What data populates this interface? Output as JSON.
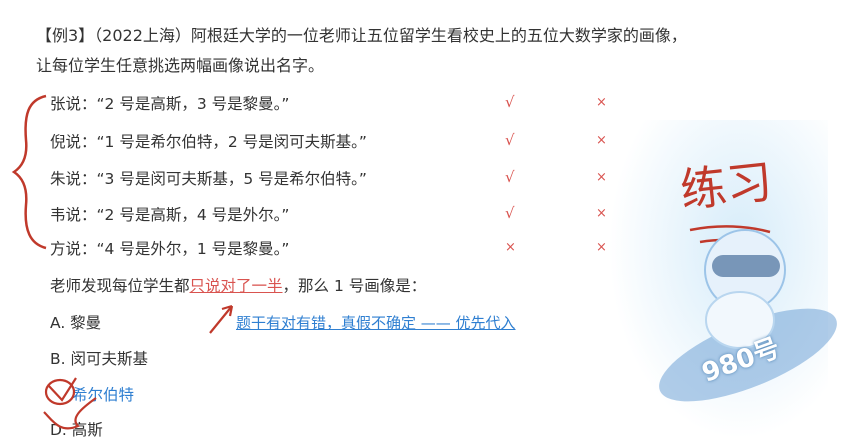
{
  "problem": {
    "line1": "【例3】（2022上海）阿根廷大学的一位老师让五位留学生看校史上的五位大数学家的画像，",
    "line2": "让每位学生任意挑选两幅画像说出名字。"
  },
  "statements": [
    {
      "text": "张说：“2 号是高斯，3 号是黎曼。”",
      "mark1": "√",
      "mark2": "×"
    },
    {
      "text": "倪说：“1 号是希尔伯特，2 号是闵可夫斯基。”",
      "mark1": "√",
      "mark2": "×"
    },
    {
      "text": "朱说：“3 号是闵可夫斯基，5 号是希尔伯特。”",
      "mark1": "√",
      "mark2": "×"
    },
    {
      "text": "韦说：“2 号是高斯，4 号是外尔。”",
      "mark1": "√",
      "mark2": "×"
    },
    {
      "text": "方说：“4 号是外尔，1 号是黎曼。”",
      "mark1": "×",
      "mark2": "×"
    }
  ],
  "question": {
    "before": "老师发现每位学生都",
    "underlined": "只说对了一半",
    "after": "，那么 1 号画像是："
  },
  "options": [
    {
      "label": "A. 黎曼"
    },
    {
      "label": "B. 闵可夫斯基"
    },
    {
      "label": "希尔伯特"
    },
    {
      "label": "D. 高斯"
    }
  ],
  "hint": "题干有对有错，真假不确定 —— 优先代入",
  "handwritten": "练习",
  "badge": "980号"
}
